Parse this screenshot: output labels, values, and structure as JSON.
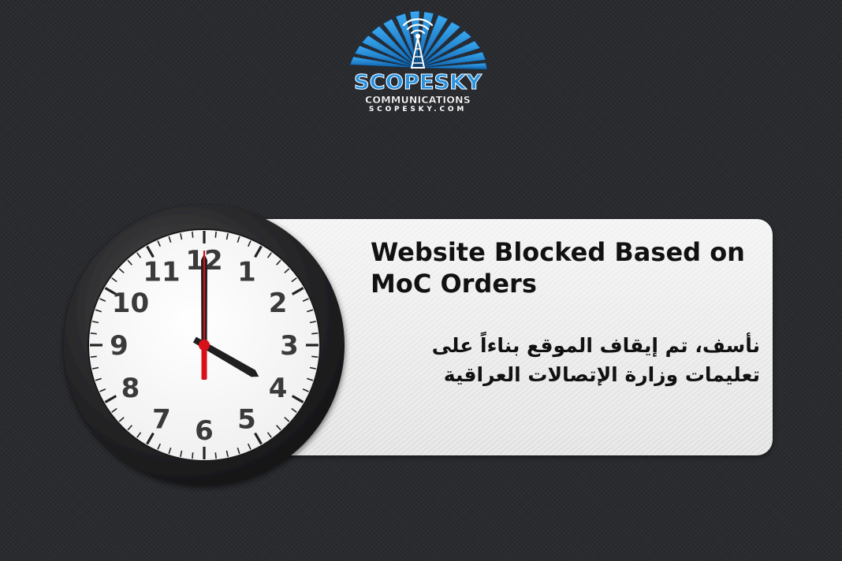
{
  "logo": {
    "name": "SCOPESKY",
    "tagline": "COMMUNICATIONS",
    "url": "SCOPESKY.COM",
    "brand_color": "#2a93e0"
  },
  "message": {
    "title": "Website Blocked Based on MoC Orders",
    "arabic": "نأسف، تم إيقاف الموقع بناءاً على تعليمات وزارة الإتصالات العراقية"
  },
  "clock": {
    "numerals": [
      "12",
      "1",
      "2",
      "3",
      "4",
      "5",
      "6",
      "7",
      "8",
      "9",
      "10",
      "11"
    ],
    "time": {
      "hour": 4,
      "minute": 0,
      "second": 0
    },
    "second_hand_color": "#d8101a"
  },
  "page": {
    "background": "#2b2c30"
  }
}
